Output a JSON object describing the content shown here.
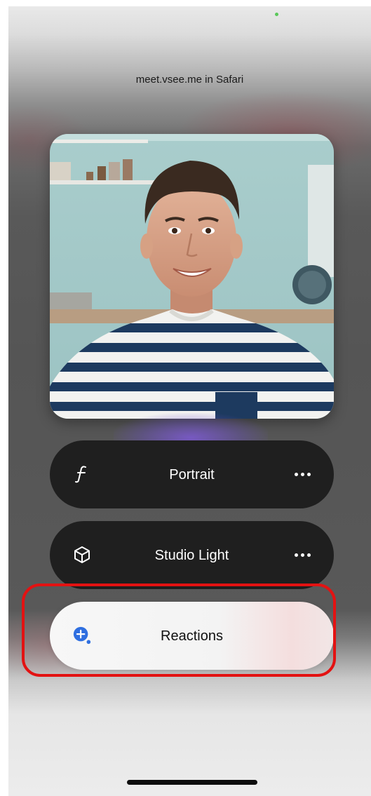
{
  "app_label": "meet.vsee.me in Safari",
  "effects": {
    "portrait": {
      "label": "Portrait",
      "icon": "f-stop-icon"
    },
    "studio_light": {
      "label": "Studio Light",
      "icon": "cube-icon"
    },
    "reactions": {
      "label": "Reactions",
      "icon": "reactions-plus-bubble-icon"
    }
  },
  "colors": {
    "highlight": "#e31212",
    "reactions_accent": "#2f6fe0",
    "indicator_dot": "#5ac85a"
  }
}
